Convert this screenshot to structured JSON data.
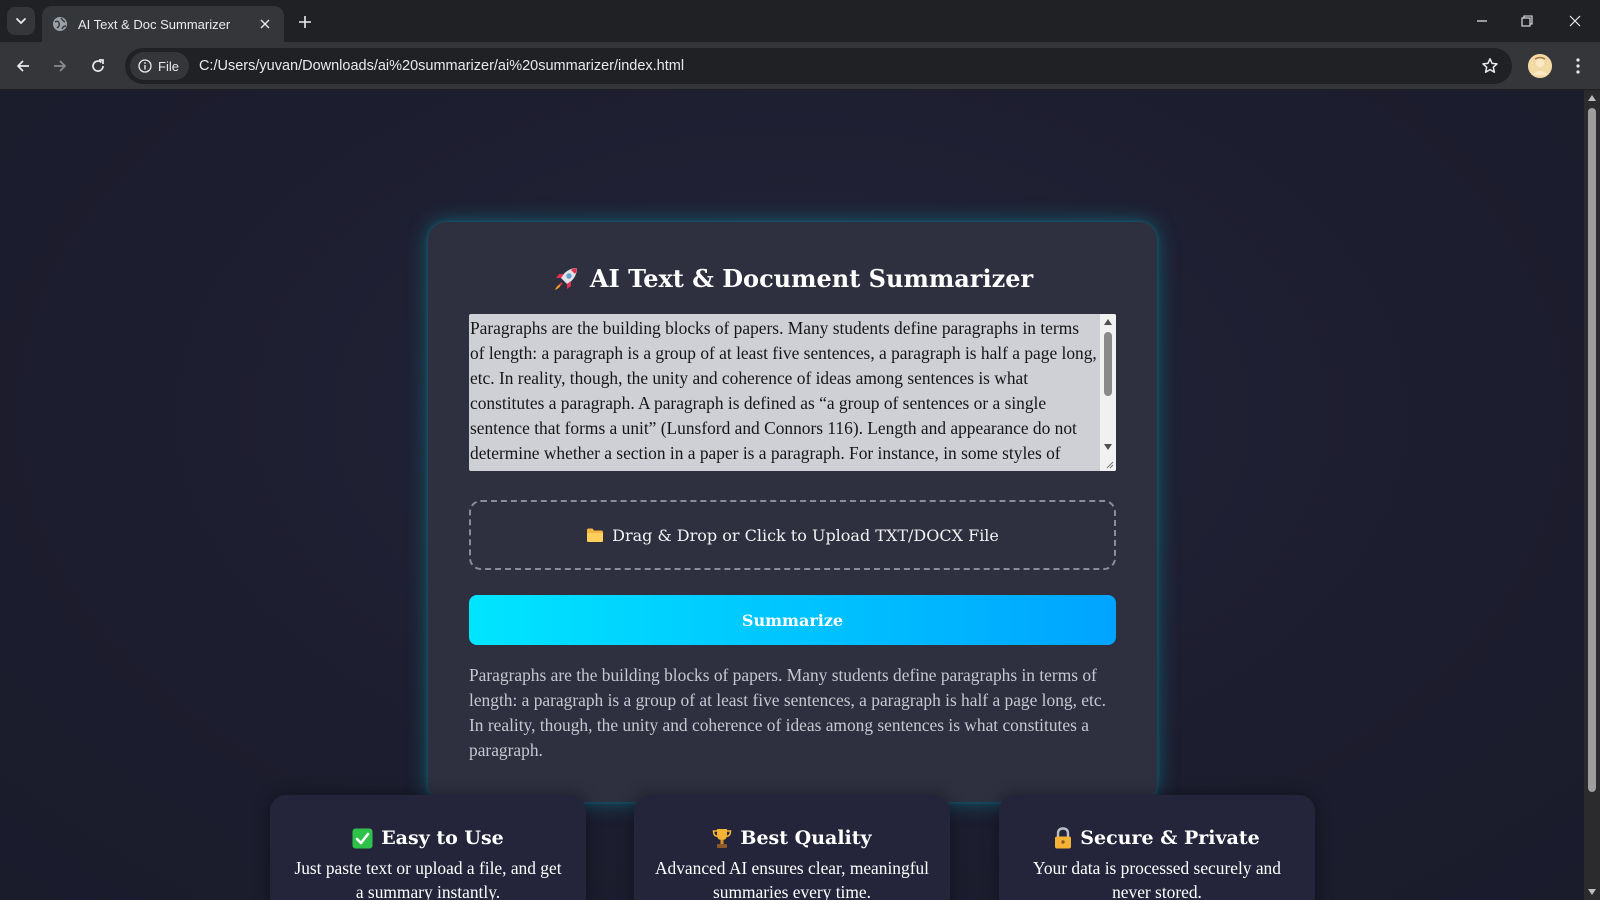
{
  "browser": {
    "tab_title": "AI Text & Doc Summarizer",
    "url_chip": "File",
    "url": "C:/Users/yuvan/Downloads/ai%20summarizer/ai%20summarizer/index.html"
  },
  "app": {
    "title": "AI Text & Document Summarizer",
    "title_icon": "rocket-icon",
    "input_text": "Paragraphs are the building blocks of papers. Many students define paragraphs in terms of length: a paragraph is a group of at least five sentences, a paragraph is half a page long, etc. In reality, though, the unity and coherence of ideas among sentences is what constitutes a paragraph. A paragraph is defined as “a group of sentences or a single sentence that forms a unit” (Lunsford and Connors 116). Length and appearance do not determine whether a section in a paper is a paragraph. For instance, in some styles of writing, particularly journalistic styles, a paragraph can be just one sentence long.",
    "upload_label": "Drag & Drop or Click to Upload TXT/DOCX File",
    "upload_icon": "folder-icon",
    "summarize_label": "Summarize",
    "summary": "Paragraphs are the building blocks of papers. Many students define paragraphs in terms of length: a paragraph is a group of at least five sentences, a paragraph is half a page long, etc. In reality, though, the unity and coherence of ideas among sentences is what constitutes a paragraph."
  },
  "features": [
    {
      "icon": "check-icon",
      "title": "Easy to Use",
      "text": "Just paste text or upload a file, and get a summary instantly."
    },
    {
      "icon": "trophy-icon",
      "title": "Best Quality",
      "text": "Advanced AI ensures clear, meaningful summaries every time."
    },
    {
      "icon": "lock-icon",
      "title": "Secure & Private",
      "text": "Your data is processed securely and never stored."
    }
  ],
  "colors": {
    "background": "#1c1d2e",
    "card": "#2e2f3f",
    "accent_start": "#00e5ff",
    "accent_end": "#00a4ff"
  }
}
